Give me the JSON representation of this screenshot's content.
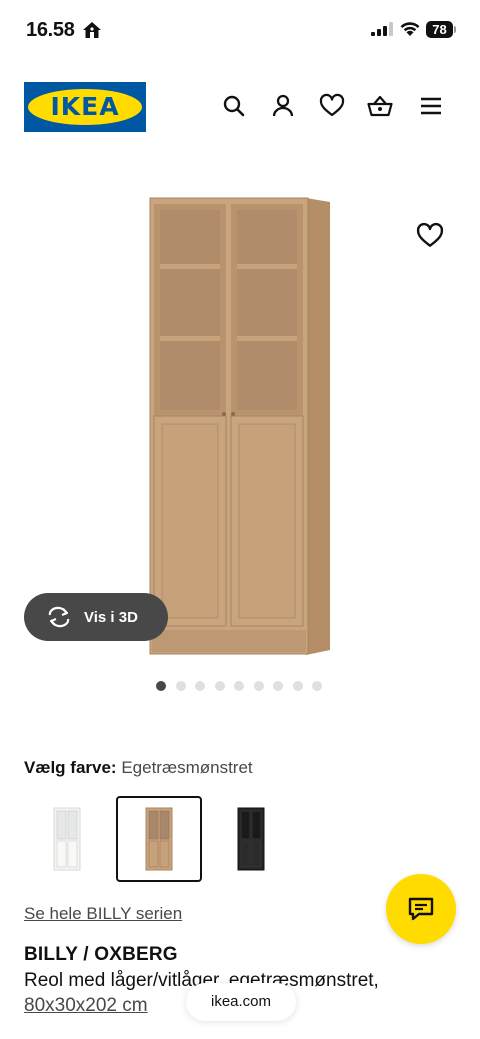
{
  "status_bar": {
    "time": "16.58",
    "battery": "78"
  },
  "header": {
    "logo_text": "IKEA",
    "icons": [
      "search-icon",
      "profile-icon",
      "heart-icon",
      "basket-icon",
      "menu-icon"
    ]
  },
  "gallery": {
    "view_3d_label": "Vis i 3D",
    "dot_count": 9,
    "active_dot": 1
  },
  "color": {
    "label": "Vælg farve:",
    "value": "Egetræsmønstret",
    "swatches": [
      {
        "name": "white",
        "selected": false
      },
      {
        "name": "oak-effect",
        "selected": true
      },
      {
        "name": "black",
        "selected": false
      }
    ]
  },
  "series_link": "Se hele BILLY serien",
  "product": {
    "name": "BILLY / OXBERG",
    "description": "Reol med låger/vitlåger, egetræsmønstret,",
    "size": "80x30x202 cm"
  },
  "browser": {
    "url": "ikea.com"
  },
  "colors": {
    "ikea_blue": "#0058a3",
    "ikea_yellow": "#ffdb00",
    "wood": "#c8a17a",
    "dark_pill": "#484848"
  }
}
